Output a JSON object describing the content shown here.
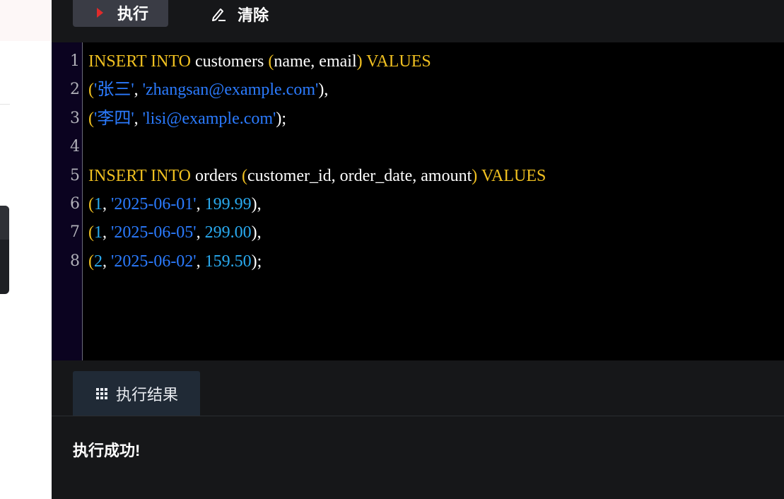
{
  "toolbar": {
    "run_label": "执行",
    "clear_label": "清除",
    "run_icon": "play-icon",
    "clear_icon": "edit-icon"
  },
  "editor": {
    "line_numbers": [
      "1",
      "2",
      "3",
      "4",
      "5",
      "6",
      "7",
      "8"
    ],
    "lines": [
      [
        {
          "t": "kw",
          "v": "INSERT INTO"
        },
        {
          "t": "id",
          "v": " customers "
        },
        {
          "t": "pn",
          "v": "("
        },
        {
          "t": "id",
          "v": "name, email"
        },
        {
          "t": "pn",
          "v": ")"
        },
        {
          "t": "kw",
          "v": " VALUES"
        }
      ],
      [
        {
          "t": "pn",
          "v": "("
        },
        {
          "t": "str",
          "v": "'张三'"
        },
        {
          "t": "plain",
          "v": ", "
        },
        {
          "t": "str",
          "v": "'zhangsan@example.com'"
        },
        {
          "t": "plain",
          "v": "),"
        }
      ],
      [
        {
          "t": "pn",
          "v": "("
        },
        {
          "t": "str",
          "v": "'李四'"
        },
        {
          "t": "plain",
          "v": ", "
        },
        {
          "t": "str",
          "v": "'lisi@example.com'"
        },
        {
          "t": "plain",
          "v": ");"
        }
      ],
      [],
      [
        {
          "t": "kw",
          "v": "INSERT INTO"
        },
        {
          "t": "id",
          "v": " orders "
        },
        {
          "t": "pn",
          "v": "("
        },
        {
          "t": "id",
          "v": "customer_id, order_date, amount"
        },
        {
          "t": "pn",
          "v": ")"
        },
        {
          "t": "kw",
          "v": " VALUES"
        }
      ],
      [
        {
          "t": "pn",
          "v": "("
        },
        {
          "t": "num",
          "v": "1"
        },
        {
          "t": "plain",
          "v": ", "
        },
        {
          "t": "str",
          "v": "'2025-06-01'"
        },
        {
          "t": "plain",
          "v": ", "
        },
        {
          "t": "num",
          "v": "199.99"
        },
        {
          "t": "plain",
          "v": "),"
        }
      ],
      [
        {
          "t": "pn",
          "v": "("
        },
        {
          "t": "num",
          "v": "1"
        },
        {
          "t": "plain",
          "v": ", "
        },
        {
          "t": "str",
          "v": "'2025-06-05'"
        },
        {
          "t": "plain",
          "v": ", "
        },
        {
          "t": "num",
          "v": "299.00"
        },
        {
          "t": "plain",
          "v": "),"
        }
      ],
      [
        {
          "t": "pn",
          "v": "("
        },
        {
          "t": "num",
          "v": "2"
        },
        {
          "t": "plain",
          "v": ", "
        },
        {
          "t": "str",
          "v": "'2025-06-02'"
        },
        {
          "t": "plain",
          "v": ", "
        },
        {
          "t": "num",
          "v": "159.50"
        },
        {
          "t": "plain",
          "v": ");"
        }
      ]
    ]
  },
  "results": {
    "tab_label": "执行结果",
    "tab_icon": "grid-icon",
    "message": "执行成功!"
  },
  "colors": {
    "keyword": "#f0c020",
    "string": "#2b7bff",
    "number": "#29aaf0",
    "run_accent": "#e02b2b"
  }
}
